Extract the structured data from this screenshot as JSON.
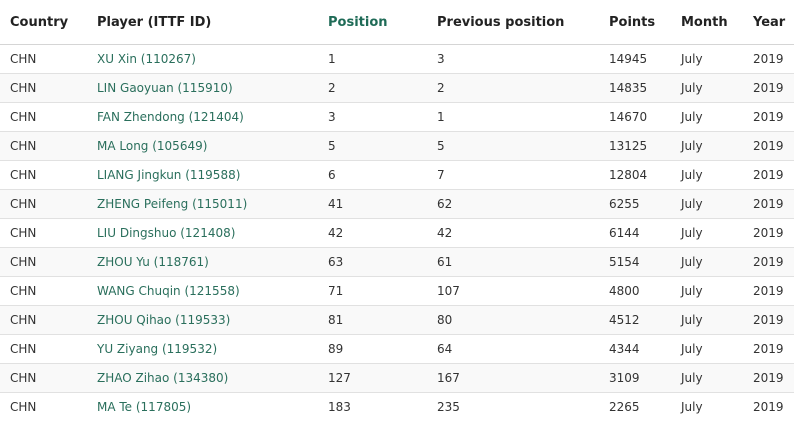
{
  "columns": {
    "country": "Country",
    "player": "Player (ITTF ID)",
    "position": "Position",
    "previous_position": "Previous position",
    "points": "Points",
    "month": "Month",
    "year": "Year"
  },
  "sorted_column": "position",
  "colors": {
    "header_sorted": "#1f6b57",
    "link": "#2a6f5c",
    "row_alt": "#f9f9f9"
  },
  "rows": [
    {
      "country": "CHN",
      "player": "XU Xin (110267)",
      "position": "1",
      "previous_position": "3",
      "points": "14945",
      "month": "July",
      "year": "2019"
    },
    {
      "country": "CHN",
      "player": "LIN Gaoyuan (115910)",
      "position": "2",
      "previous_position": "2",
      "points": "14835",
      "month": "July",
      "year": "2019"
    },
    {
      "country": "CHN",
      "player": "FAN Zhendong (121404)",
      "position": "3",
      "previous_position": "1",
      "points": "14670",
      "month": "July",
      "year": "2019"
    },
    {
      "country": "CHN",
      "player": "MA Long (105649)",
      "position": "5",
      "previous_position": "5",
      "points": "13125",
      "month": "July",
      "year": "2019"
    },
    {
      "country": "CHN",
      "player": "LIANG Jingkun (119588)",
      "position": "6",
      "previous_position": "7",
      "points": "12804",
      "month": "July",
      "year": "2019"
    },
    {
      "country": "CHN",
      "player": "ZHENG Peifeng (115011)",
      "position": "41",
      "previous_position": "62",
      "points": "6255",
      "month": "July",
      "year": "2019"
    },
    {
      "country": "CHN",
      "player": "LIU Dingshuo (121408)",
      "position": "42",
      "previous_position": "42",
      "points": "6144",
      "month": "July",
      "year": "2019"
    },
    {
      "country": "CHN",
      "player": "ZHOU Yu (118761)",
      "position": "63",
      "previous_position": "61",
      "points": "5154",
      "month": "July",
      "year": "2019"
    },
    {
      "country": "CHN",
      "player": "WANG Chuqin (121558)",
      "position": "71",
      "previous_position": "107",
      "points": "4800",
      "month": "July",
      "year": "2019"
    },
    {
      "country": "CHN",
      "player": "ZHOU Qihao (119533)",
      "position": "81",
      "previous_position": "80",
      "points": "4512",
      "month": "July",
      "year": "2019"
    },
    {
      "country": "CHN",
      "player": "YU Ziyang (119532)",
      "position": "89",
      "previous_position": "64",
      "points": "4344",
      "month": "July",
      "year": "2019"
    },
    {
      "country": "CHN",
      "player": "ZHAO Zihao (134380)",
      "position": "127",
      "previous_position": "167",
      "points": "3109",
      "month": "July",
      "year": "2019"
    },
    {
      "country": "CHN",
      "player": "MA Te (117805)",
      "position": "183",
      "previous_position": "235",
      "points": "2265",
      "month": "July",
      "year": "2019"
    }
  ]
}
